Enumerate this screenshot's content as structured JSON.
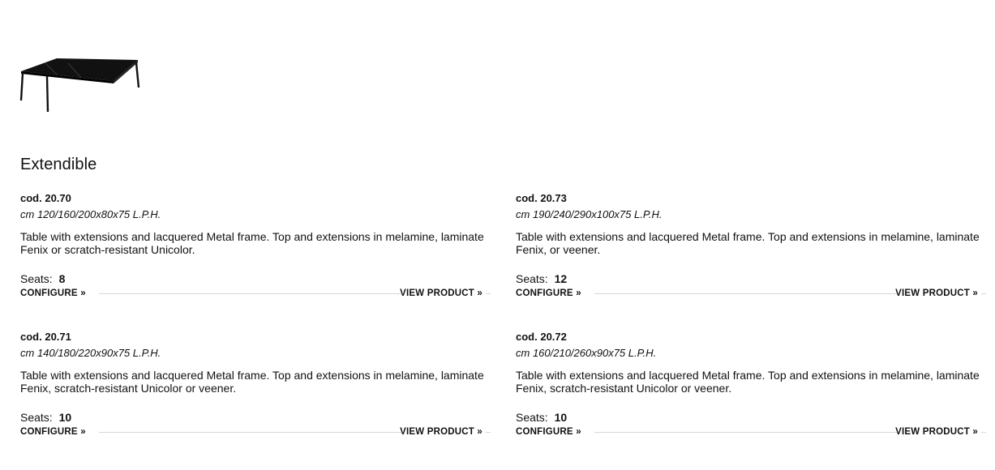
{
  "section": {
    "title": "Extendible"
  },
  "products": [
    {
      "code": "cod. 20.70",
      "dimensions": "cm 120/160/200x80x75 L.P.H.",
      "description": "Table with extensions and lacquered Metal frame. Top and extensions in melamine, laminate Fenix or scratch-resistant Unicolor.",
      "seats_label": "Seats:",
      "seats": "8",
      "configure_label": "CONFIGURE »",
      "view_label": "VIEW PRODUCT »"
    },
    {
      "code": "cod. 20.73",
      "dimensions": "cm 190/240/290x100x75 L.P.H.",
      "description": "Table with extensions and lacquered Metal frame. Top and extensions in melamine, laminate Fenix, or veener.",
      "seats_label": "Seats:",
      "seats": "12",
      "configure_label": "CONFIGURE »",
      "view_label": "VIEW PRODUCT »"
    },
    {
      "code": "cod. 20.71",
      "dimensions": "cm 140/180/220x90x75 L.P.H.",
      "description": "Table with extensions and lacquered Metal frame. Top and extensions in melamine, laminate Fenix, scratch-resistant Unicolor or veener.",
      "seats_label": "Seats:",
      "seats": "10",
      "configure_label": "CONFIGURE »",
      "view_label": "VIEW PRODUCT »"
    },
    {
      "code": "cod. 20.72",
      "dimensions": "cm 160/210/260x90x75 L.P.H.",
      "description": "Table with extensions and lacquered Metal frame. Top and extensions in melamine, laminate Fenix, scratch-resistant Unicolor or veener.",
      "seats_label": "Seats:",
      "seats": "10",
      "configure_label": "CONFIGURE »",
      "view_label": "VIEW PRODUCT »"
    }
  ]
}
